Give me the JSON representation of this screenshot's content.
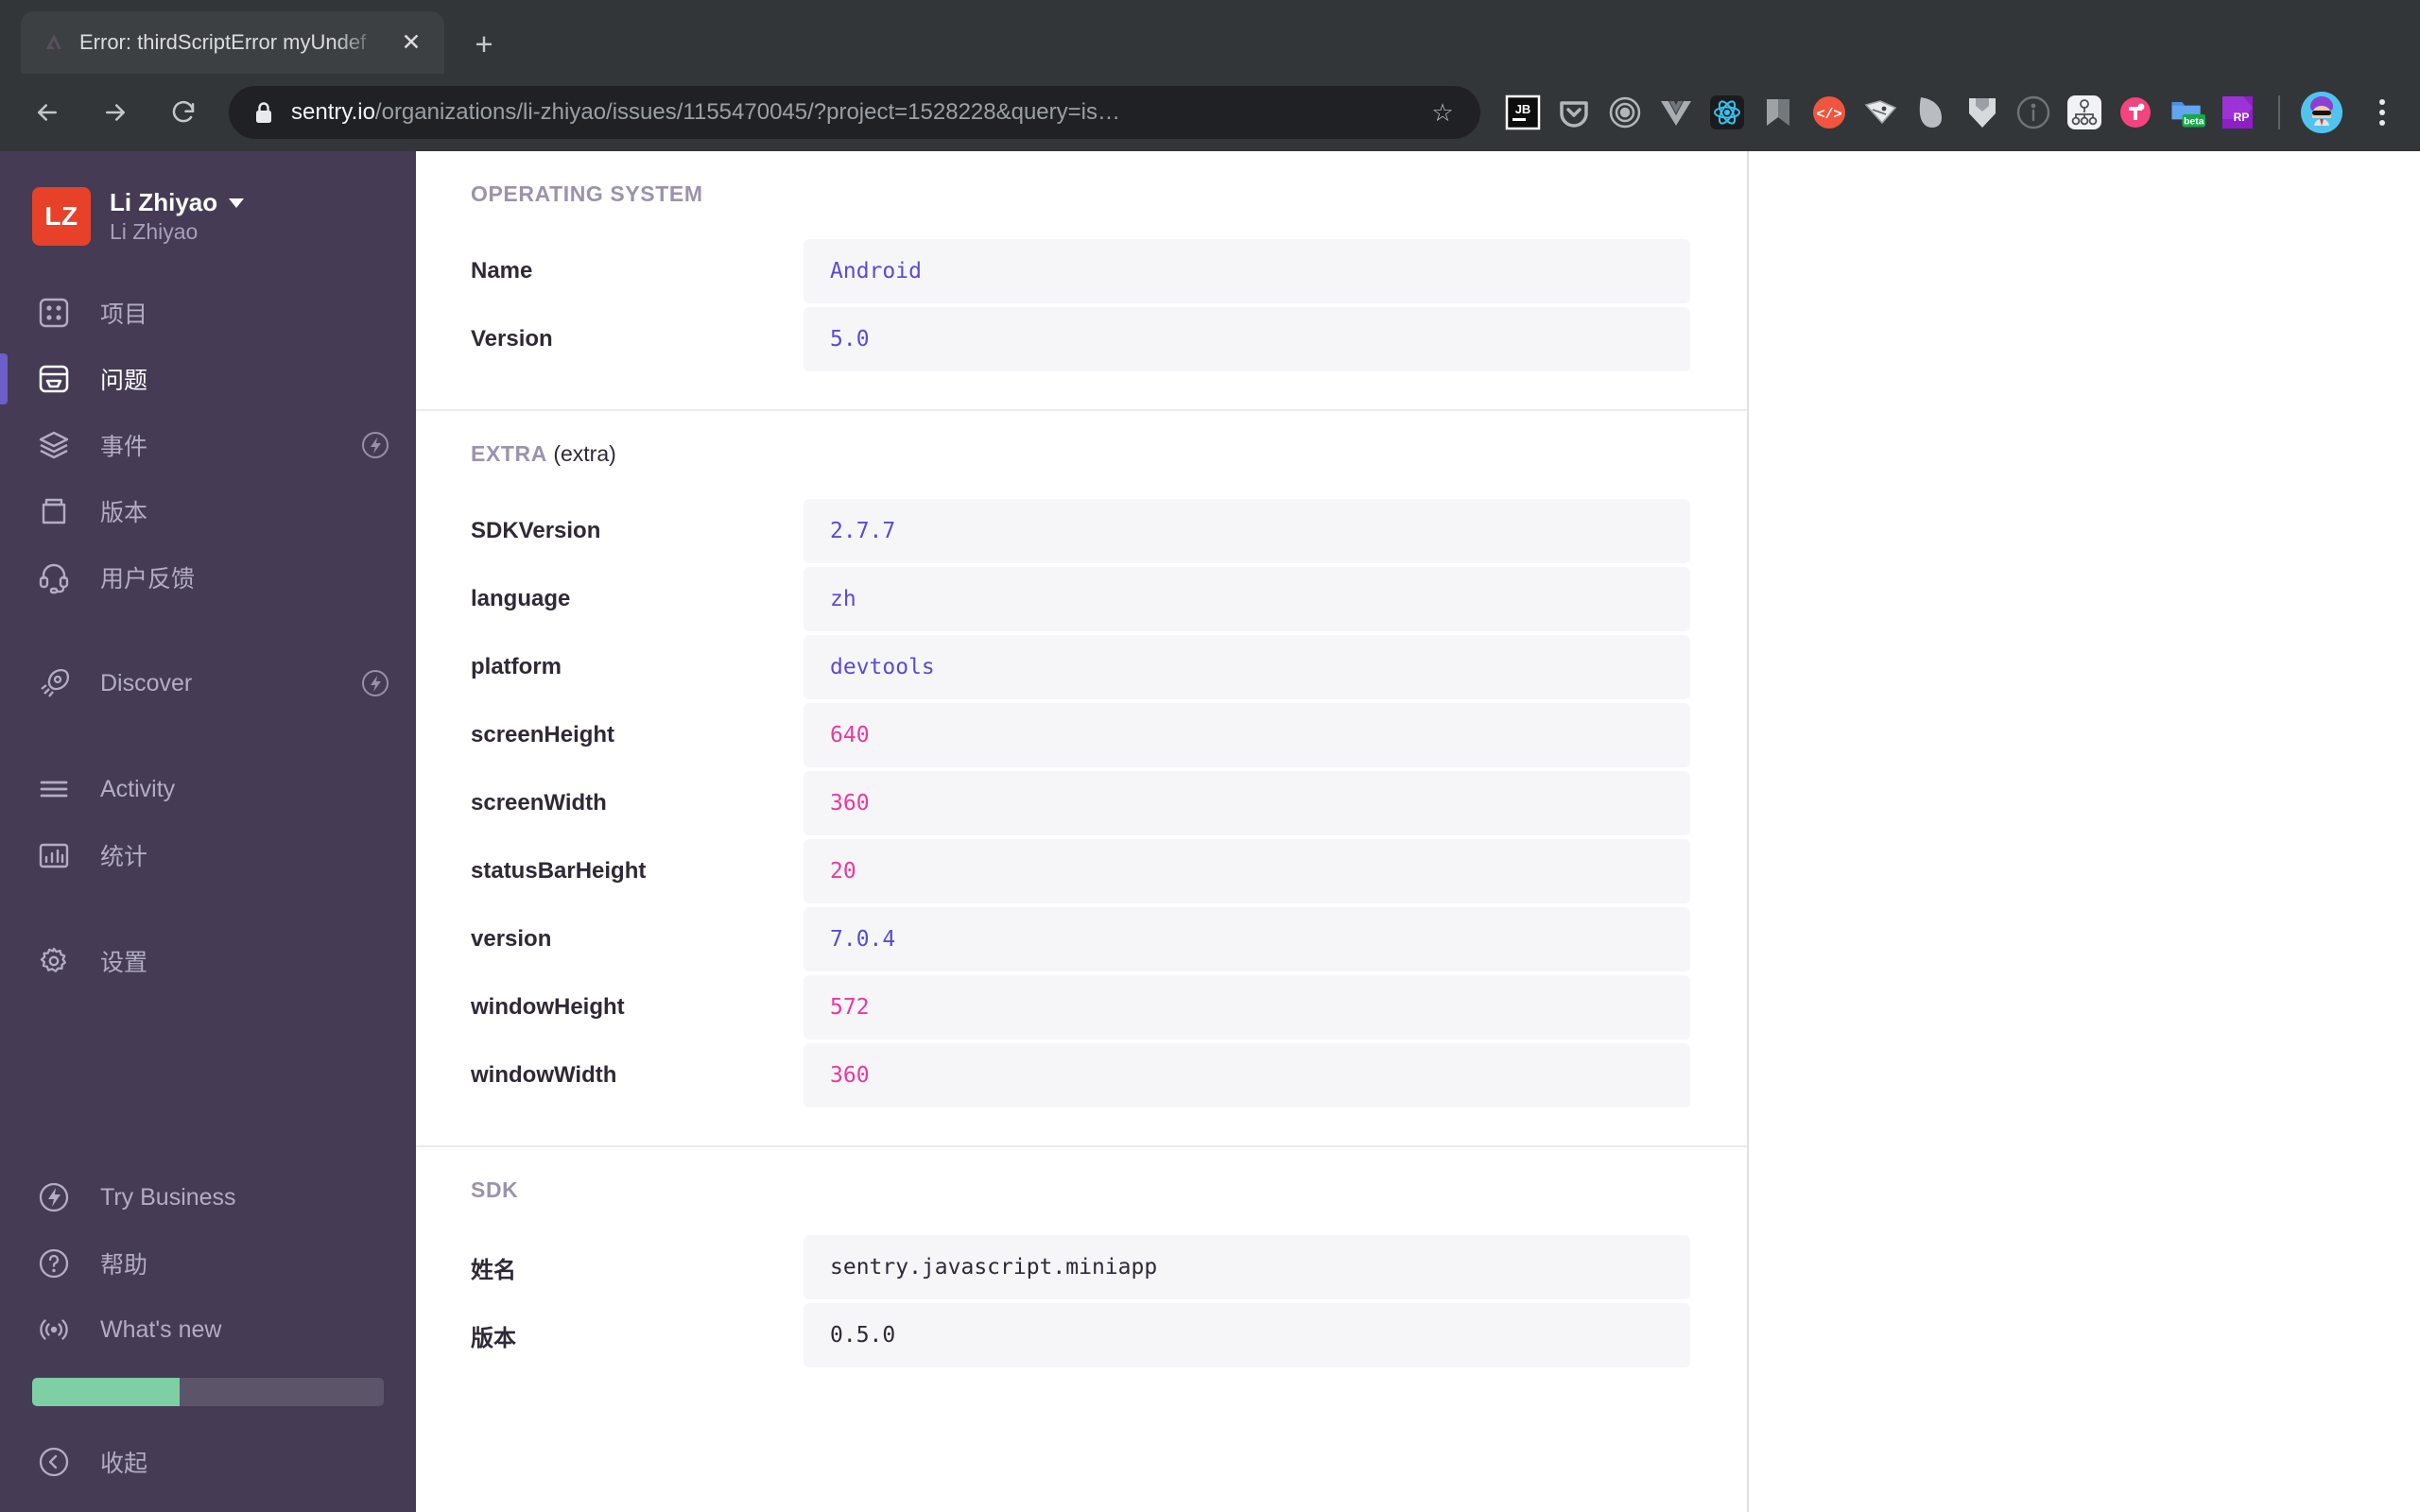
{
  "browser": {
    "tab": {
      "title": "Error: thirdScriptError myUndef",
      "favicon": "sentry-favicon",
      "close_label": "✕"
    },
    "new_tab_label": "+",
    "nav": {
      "back": "back-arrow",
      "forward": "forward-arrow",
      "reload": "reload-arrow"
    },
    "omnibox": {
      "lock": "lock-icon",
      "host": "sentry.io",
      "path": "/organizations/li-zhiyao/issues/1155470045/?project=1528228&query=is…",
      "star": "☆"
    },
    "extensions": [
      {
        "name": "jetbrains-toolbox-extension",
        "label": "JB"
      },
      {
        "name": "pocket-extension",
        "label": ""
      },
      {
        "name": "circle-target-extension",
        "label": ""
      },
      {
        "name": "vuejs-devtools-extension",
        "label": ""
      },
      {
        "name": "react-devtools-extension",
        "label": ""
      },
      {
        "name": "bookmark-arrow-extension",
        "label": ""
      },
      {
        "name": "code-snippet-extension",
        "label": "</>"
      },
      {
        "name": "paper-note-extension",
        "label": ""
      },
      {
        "name": "leaf-extension",
        "label": ""
      },
      {
        "name": "shield-extension",
        "label": ""
      },
      {
        "name": "info-circle-extension",
        "label": ""
      },
      {
        "name": "sitemap-extension",
        "label": ""
      },
      {
        "name": "pink-tool-extension",
        "label": ""
      },
      {
        "name": "folder-beta-extension",
        "label": "beta"
      },
      {
        "name": "rp-purple-extension",
        "label": "RP"
      }
    ],
    "profile_avatar": "user-avatar",
    "menu": "kebab-menu"
  },
  "sidebar": {
    "org": {
      "initials": "LZ",
      "name": "Li Zhiyao",
      "subname": "Li Zhiyao"
    },
    "primary_nav": [
      {
        "icon": "grid-icon",
        "label": "项目",
        "active": false,
        "badge": false
      },
      {
        "icon": "issues-icon",
        "label": "问题",
        "active": true,
        "badge": false
      },
      {
        "icon": "layers-icon",
        "label": "事件",
        "active": false,
        "badge": true
      },
      {
        "icon": "releases-icon",
        "label": "版本",
        "active": false,
        "badge": false
      },
      {
        "icon": "headset-icon",
        "label": "用户反馈",
        "active": false,
        "badge": false
      }
    ],
    "secondary_nav": [
      {
        "icon": "rocket-icon",
        "label": "Discover",
        "active": false,
        "badge": true
      }
    ],
    "tertiary_nav": [
      {
        "icon": "activity-lines-icon",
        "label": "Activity",
        "active": false,
        "badge": false
      },
      {
        "icon": "stats-bar-icon",
        "label": "统计",
        "active": false,
        "badge": false
      }
    ],
    "settings_nav": [
      {
        "icon": "gear-icon",
        "label": "设置",
        "active": false,
        "badge": false
      }
    ],
    "bottom_nav": [
      {
        "icon": "bolt-circle-icon",
        "label": "Try Business",
        "active": false,
        "badge": false
      },
      {
        "icon": "question-icon",
        "label": "帮助",
        "active": false,
        "badge": false
      },
      {
        "icon": "broadcast-icon",
        "label": "What's new",
        "active": false,
        "badge": false
      }
    ],
    "usage": {
      "percent": 42,
      "fill_color": "#7ecfa3",
      "track_color": "#5c5469"
    },
    "collapse": {
      "icon": "chevron-left-circle-icon",
      "label": "收起"
    }
  },
  "main": {
    "sections": [
      {
        "name": "operating-system",
        "heading": "OPERATING SYSTEM",
        "subheading": "",
        "rows": [
          {
            "key": "Name",
            "value": "Android",
            "type": "str"
          },
          {
            "key": "Version",
            "value": "5.0",
            "type": "str"
          }
        ]
      },
      {
        "name": "extra",
        "heading": "EXTRA",
        "subheading": "(extra)",
        "rows": [
          {
            "key": "SDKVersion",
            "value": "2.7.7",
            "type": "str"
          },
          {
            "key": "language",
            "value": "zh",
            "type": "str"
          },
          {
            "key": "platform",
            "value": "devtools",
            "type": "str"
          },
          {
            "key": "screenHeight",
            "value": "640",
            "type": "num"
          },
          {
            "key": "screenWidth",
            "value": "360",
            "type": "num"
          },
          {
            "key": "statusBarHeight",
            "value": "20",
            "type": "num"
          },
          {
            "key": "version",
            "value": "7.0.4",
            "type": "str"
          },
          {
            "key": "windowHeight",
            "value": "572",
            "type": "num"
          },
          {
            "key": "windowWidth",
            "value": "360",
            "type": "num"
          }
        ]
      },
      {
        "name": "sdk",
        "heading": "SDK",
        "subheading": "",
        "rows": [
          {
            "key": "姓名",
            "value": "sentry.javascript.miniapp",
            "type": "plain"
          },
          {
            "key": "版本",
            "value": "0.5.0",
            "type": "plain"
          }
        ]
      }
    ]
  },
  "colors": {
    "sidebar_bg": "#453b55",
    "accent_purple": "#6c5fc7",
    "brand_red": "#e8412a",
    "value_string": "#5b4ad6",
    "value_number": "#f0379e",
    "usage_green": "#7ecfa3"
  }
}
